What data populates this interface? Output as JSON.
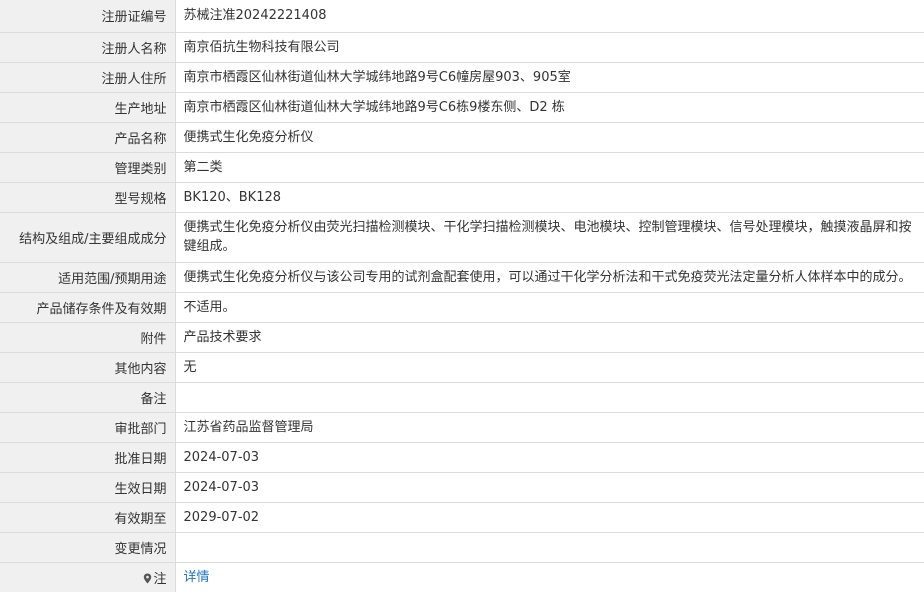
{
  "rows": [
    {
      "label": "注册证编号",
      "value": "苏械注准20242221408"
    },
    {
      "label": "注册人名称",
      "value": "南京佰抗生物科技有限公司"
    },
    {
      "label": "注册人住所",
      "value": "南京市栖霞区仙林街道仙林大学城纬地路9号C6幢房屋903、905室"
    },
    {
      "label": "生产地址",
      "value": "南京市栖霞区仙林街道仙林大学城纬地路9号C6栋9楼东侧、D2 栋"
    },
    {
      "label": "产品名称",
      "value": "便携式生化免疫分析仪"
    },
    {
      "label": "管理类别",
      "value": "第二类"
    },
    {
      "label": "型号规格",
      "value": "BK120、BK128"
    },
    {
      "label": "结构及组成/主要组成成分",
      "value": "便携式生化免疫分析仪由荧光扫描检测模块、干化学扫描检测模块、电池模块、控制管理模块、信号处理模块，触摸液晶屏和按键组成。"
    },
    {
      "label": "适用范围/预期用途",
      "value": "便携式生化免疫分析仪与该公司专用的试剂盒配套使用，可以通过干化学分析法和干式免疫荧光法定量分析人体样本中的成分。"
    },
    {
      "label": "产品储存条件及有效期",
      "value": "不适用。"
    },
    {
      "label": "附件",
      "value": "产品技术要求"
    },
    {
      "label": "其他内容",
      "value": "无"
    },
    {
      "label": "备注",
      "value": ""
    },
    {
      "label": "审批部门",
      "value": "江苏省药品监督管理局"
    },
    {
      "label": "批准日期",
      "value": "2024-07-03"
    },
    {
      "label": "生效日期",
      "value": "2024-07-03"
    },
    {
      "label": "有效期至",
      "value": "2029-07-02"
    },
    {
      "label": "变更情况",
      "value": ""
    }
  ],
  "note": {
    "label": "注",
    "icon": "map-pin-icon",
    "link_text": "详情",
    "link_color": "#1e73c8"
  }
}
